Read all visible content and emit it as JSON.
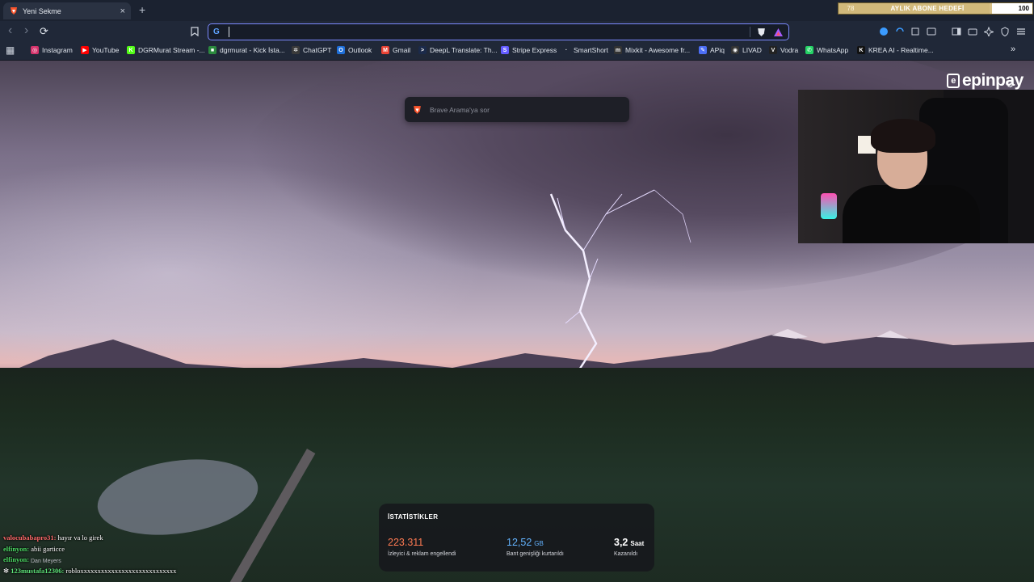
{
  "tab": {
    "title": "Yeni Sekme",
    "close": "×",
    "new_tab": "+"
  },
  "goal": {
    "label": "AYLIK ABONE HEDEFİ",
    "current": "78",
    "target": "100",
    "progress": 0.78,
    "bar_color": "#d8c188"
  },
  "toolbar": {
    "back": "‹",
    "forward": "›",
    "reload": "⟳",
    "address_value": "",
    "search_engine_icon": "G"
  },
  "bookmarks": [
    {
      "label": "Instagram",
      "color": "#d6336c",
      "glyph": "◎"
    },
    {
      "label": "YouTube",
      "color": "#ff0000",
      "glyph": "▶"
    },
    {
      "label": "DGRMurat Stream -...",
      "color": "#53fc18",
      "glyph": "K"
    },
    {
      "label": "dgrmurat - Kick İsta...",
      "color": "#2b8a3e",
      "glyph": "■"
    },
    {
      "label": "ChatGPT",
      "color": "#3a3a3a",
      "glyph": "✲"
    },
    {
      "label": "Outlook",
      "color": "#1e6fd9",
      "glyph": "O"
    },
    {
      "label": "Gmail",
      "color": "#ea4335",
      "glyph": "M"
    },
    {
      "label": "DeepL Translate: Th...",
      "color": "#1b2a4a",
      "glyph": ">"
    },
    {
      "label": "Stripe Express",
      "color": "#635bff",
      "glyph": "S"
    },
    {
      "label": "SmartShort",
      "color": "#202838",
      "glyph": "·"
    },
    {
      "label": "Mixkit - Awesome fr...",
      "color": "#333",
      "glyph": "m"
    },
    {
      "label": "APiq",
      "color": "#4c6ef5",
      "glyph": "✎"
    },
    {
      "label": "LIVAD",
      "color": "#333",
      "glyph": "◉"
    },
    {
      "label": "Vodra",
      "color": "#222",
      "glyph": "V"
    },
    {
      "label": "WhatsApp",
      "color": "#25d366",
      "glyph": "✆"
    },
    {
      "label": "KREA AI - Realtime...",
      "color": "#111",
      "glyph": "K"
    }
  ],
  "overflow": "»",
  "apps_icon": "▦",
  "search": {
    "placeholder": "Brave Arama'ya sor"
  },
  "settings_icon": "⚙",
  "brand": {
    "name": "epinpay",
    "mark": "e"
  },
  "stats": {
    "heading": "İSTATİSTİKLER",
    "items": [
      {
        "value": "223.311",
        "unit": "",
        "desc": "İzleyici & reklam engellendi",
        "color": "#ff7a52"
      },
      {
        "value": "12,52",
        "unit": "GB",
        "desc": "Bant genişliği kurtarıldı",
        "color": "#63b3ff"
      },
      {
        "value": "3,2",
        "unit": "Saat",
        "desc": "Kazanıldı",
        "color": "#ffffff"
      }
    ]
  },
  "chat": [
    {
      "user": "valocubabapro31:",
      "message": "hayır va lo girek",
      "color": "#ff6b6b"
    },
    {
      "user": "elfinyon:",
      "message": "abii garticce",
      "color": "#4cd964"
    },
    {
      "user": "elfinyon:",
      "message": "",
      "color": "#4cd964"
    },
    {
      "user": "123mustafa12306:",
      "message": "robloxxxxxxxxxxxxxxxxxxxxxxxxxxxx",
      "color": "#5ee37a",
      "prefix": "✻"
    }
  ],
  "photo_credit": "Dan Meyers"
}
